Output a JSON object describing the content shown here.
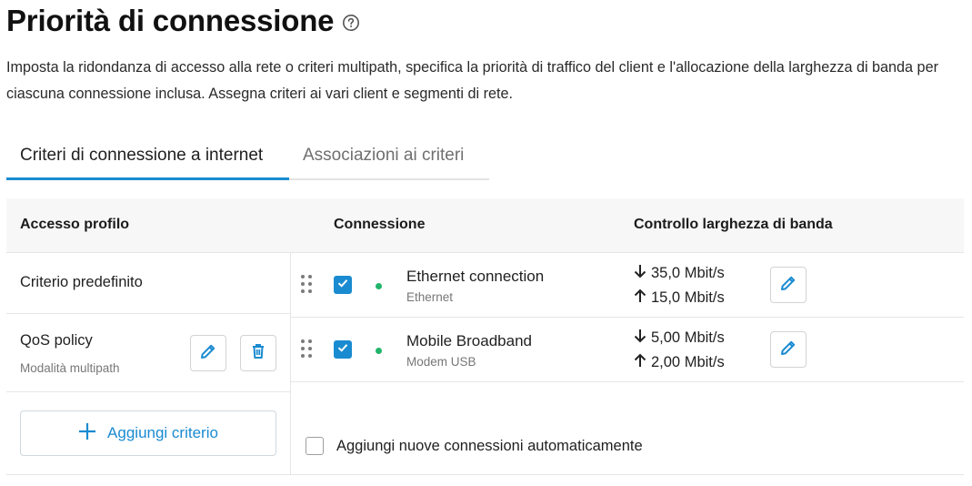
{
  "page": {
    "title": "Priorità di connessione",
    "description": "Imposta la ridondanza di accesso alla rete o criteri multipath, specifica la priorità di traffico del client e l'allocazione della larghezza di banda per ciascuna connessione inclusa. Assegna criteri ai vari client e segmenti di rete."
  },
  "tabs": [
    {
      "label": "Criteri di connessione a internet",
      "active": true
    },
    {
      "label": "Associazioni ai criteri",
      "active": false
    }
  ],
  "table": {
    "headers": {
      "profile": "Accesso profilo",
      "connection": "Connessione",
      "bandwidth": "Controllo larghezza di banda"
    },
    "profiles": [
      {
        "name": "Criterio predefinito",
        "sub": ""
      },
      {
        "name": "QoS policy",
        "sub": "Modalità multipath"
      }
    ],
    "add_button": "Aggiungi criterio",
    "connections": [
      {
        "name": "Ethernet connection",
        "type": "Ethernet",
        "checked": true,
        "status_color": "#23b46b",
        "download": "35,0 Mbit/s",
        "upload": "15,0 Mbit/s"
      },
      {
        "name": "Mobile Broadband",
        "type": "Modem USB",
        "checked": true,
        "status_color": "#23b46b",
        "download": "5,00 Mbit/s",
        "upload": "2,00 Mbit/s"
      }
    ],
    "auto_add_label": "Aggiungi nuove connessioni automaticamente",
    "auto_add_checked": false
  },
  "colors": {
    "accent": "#1a8bd1",
    "status_online": "#23b46b"
  },
  "icons": {
    "help": "help-circle-icon",
    "edit": "pencil-icon",
    "delete": "trash-icon",
    "drag": "drag-handle-icon",
    "add": "plus-icon",
    "down": "arrow-down-icon",
    "up": "arrow-up-icon"
  }
}
